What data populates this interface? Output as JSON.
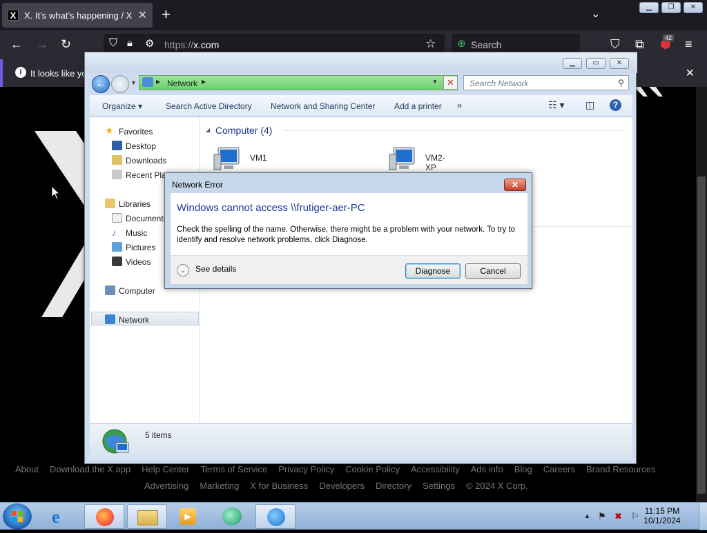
{
  "browser": {
    "tab_title": "X. It’s what’s happening / X",
    "tab_favicon": "X",
    "new_tab": "+",
    "url_scheme": "https://",
    "url_host": "x.com",
    "search_placeholder": "Search",
    "extension_badge": "42",
    "notification_text": "It looks like you",
    "accent": "#6f5ce0"
  },
  "footer": {
    "row1": [
      "About",
      "Download the X app",
      "Help Center",
      "Terms of Service",
      "Privacy Policy",
      "Cookie Policy",
      "Accessibility",
      "Ads info",
      "Blog",
      "Careers",
      "Brand Resources"
    ],
    "row2": [
      "Advertising",
      "Marketing",
      "X for Business",
      "Developers",
      "Directory",
      "Settings",
      "© 2024 X Corp."
    ]
  },
  "explorer": {
    "address": "Network",
    "search_placeholder": "Search Network",
    "toolbar": {
      "organize": "Organize",
      "search_ad": "Search Active Directory",
      "network_sharing": "Network and Sharing Center",
      "add_printer": "Add a printer",
      "more": "»"
    },
    "nav": {
      "favorites": "Favorites",
      "desktop": "Desktop",
      "downloads": "Downloads",
      "recent": "Recent Places",
      "libraries": "Libraries",
      "documents": "Documents",
      "music": "Music",
      "pictures": "Pictures",
      "videos": "Videos",
      "computer": "Computer",
      "network": "Network"
    },
    "group_header": "Computer (4)",
    "computers": [
      "VM1",
      "VM2-XP"
    ],
    "status": "5 items"
  },
  "dialog": {
    "title": "Network Error",
    "close": "✕",
    "main": "Windows cannot access \\\\frutiger-aer-PC",
    "message": "Check the spelling of the name. Otherwise, there might be a problem with your network. To try to identify and resolve network problems, click Diagnose.",
    "see_details": "See details",
    "diagnose": "Diagnose",
    "cancel": "Cancel"
  },
  "taskbar": {
    "time": "11:15 PM",
    "date": "10/1/2024"
  }
}
